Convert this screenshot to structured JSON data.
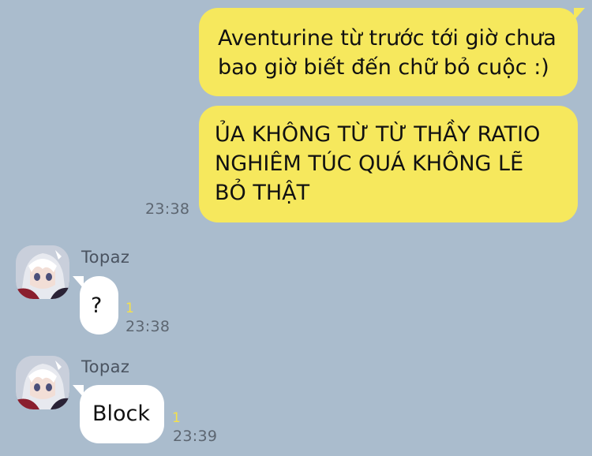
{
  "messages": {
    "outgoing": [
      {
        "text": "Aventurine từ trước tới giờ chưa\nbao giờ biết đến chữ bỏ cuộc :)"
      },
      {
        "text": "ỦA KHÔNG TỪ TỪ THẦY RATIO\nNGHIÊM TÚC QUÁ KHÔNG LẼ\nBỎ THẬT",
        "time": "23:38"
      }
    ],
    "incoming": [
      {
        "sender": "Topaz",
        "text": "?",
        "read_count": "1",
        "time": "23:38"
      },
      {
        "sender": "Topaz",
        "text": "Block",
        "read_count": "1",
        "time": "23:39"
      }
    ]
  },
  "colors": {
    "background": "#aabccd",
    "outgoing_bubble": "#f6e85d",
    "incoming_bubble": "#ffffff",
    "read_count": "#f5e14a",
    "timestamp": "#5d6671"
  }
}
